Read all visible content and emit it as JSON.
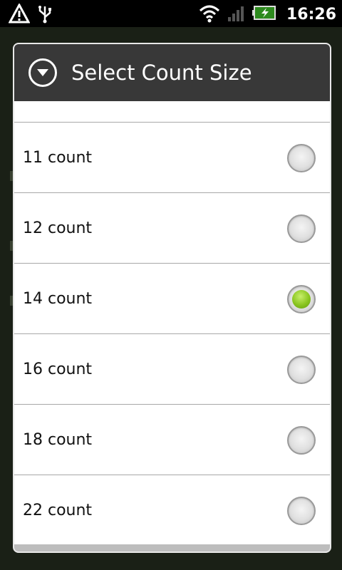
{
  "status_bar": {
    "time": "16:26",
    "icons": [
      "warning-icon",
      "usb-icon",
      "wifi-icon",
      "signal-icon",
      "battery-charging-icon"
    ]
  },
  "dialog": {
    "title": "Select Count Size",
    "title_icon": "chevron-down-circle-icon",
    "options": [
      {
        "label": "11 count",
        "selected": false
      },
      {
        "label": "12 count",
        "selected": false
      },
      {
        "label": "14 count",
        "selected": true
      },
      {
        "label": "16 count",
        "selected": false
      },
      {
        "label": "18 count",
        "selected": false
      },
      {
        "label": "22 count",
        "selected": false
      }
    ]
  },
  "colors": {
    "header_bg": "#383838",
    "radio_selected": "#8ac520",
    "divider": "#a8a8a8"
  }
}
